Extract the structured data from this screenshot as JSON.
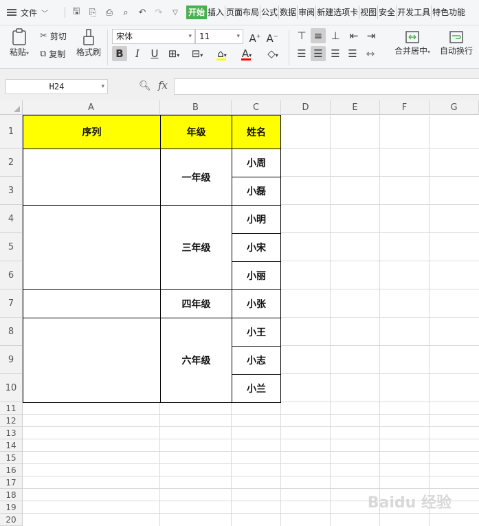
{
  "menubar": {
    "file_label": "文件",
    "tabs": [
      "开始",
      "插入",
      "页面布局",
      "公式",
      "数据",
      "审阅",
      "新建选项卡",
      "视图",
      "安全",
      "开发工具",
      "特色功能"
    ],
    "active_tab": "开始"
  },
  "ribbon": {
    "paste": "粘贴",
    "cut": "剪切",
    "copy": "复制",
    "format_painter": "格式刷",
    "font_name": "宋体",
    "font_size": "11",
    "merge_center": "合并居中",
    "wrap_text": "自动换行",
    "accent_color": "#4caf50",
    "highlight_color": "#ffff00",
    "font_color": "#ff0000"
  },
  "formula_bar": {
    "cell_ref": "H24",
    "fx_label": "fx",
    "formula": ""
  },
  "sheet": {
    "columns": [
      "A",
      "B",
      "C",
      "D",
      "E",
      "F",
      "G"
    ],
    "rows": [
      "1",
      "2",
      "3",
      "4",
      "5",
      "6",
      "7",
      "8",
      "9",
      "10",
      "11",
      "12",
      "13",
      "14",
      "15",
      "16",
      "17",
      "18",
      "19",
      "20"
    ],
    "header_fill": "#ffff00",
    "table": {
      "header": {
        "A": "序列",
        "B": "年级",
        "C": "姓名"
      },
      "grades": [
        "一年级",
        "三年级",
        "四年级",
        "六年级"
      ],
      "names": [
        "小周",
        "小磊",
        "小明",
        "小宋",
        "小丽",
        "小张",
        "小王",
        "小志",
        "小兰"
      ]
    }
  },
  "watermark": "Baidu 经验"
}
